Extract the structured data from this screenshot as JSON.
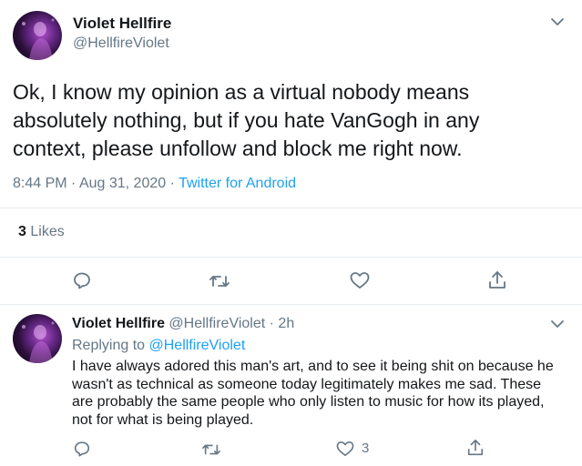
{
  "main_tweet": {
    "author_name": "Violet Hellfire",
    "author_handle": "@HellfireViolet",
    "text_lines": [
      "Ok, I know my opinion as a virtual nobody means",
      "absolutely nothing, but if you hate VanGogh in any",
      "context, please unfollow and block me right now."
    ],
    "time": "8:44 PM",
    "separator": "·",
    "date": "Aug 31, 2020",
    "source": "Twitter for Android",
    "likes_count": "3",
    "likes_label": "Likes"
  },
  "reply_tweet": {
    "author_name": "Violet Hellfire",
    "author_handle": "@HellfireViolet",
    "separator": "·",
    "age": "2h",
    "replying_to_label": "Replying to",
    "replying_to_handle": "@HellfireViolet",
    "text_lines": [
      "I have always adored this man's art, and to see it being shit on because he",
      "wasn't as technical as someone today legitimately makes me sad. These",
      "are probably the same people who only listen to music for how its played,",
      "not for what is being played."
    ],
    "like_count": "3"
  },
  "icons": {
    "reply": "reply-icon",
    "retweet": "retweet-icon",
    "like": "heart-icon",
    "share": "share-icon",
    "menu": "chevron-down-icon"
  }
}
